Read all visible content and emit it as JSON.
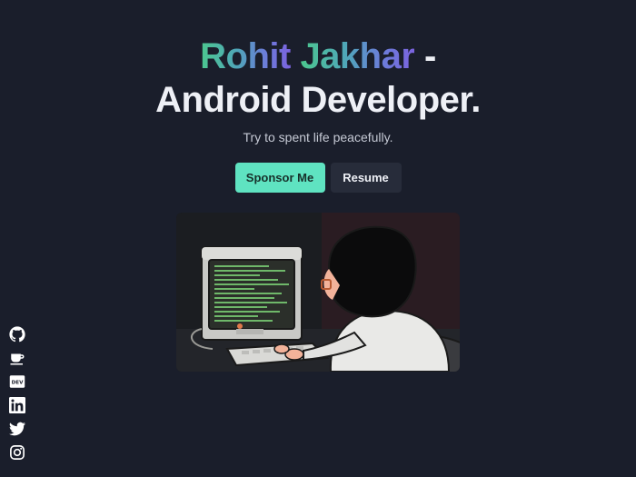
{
  "hero": {
    "first_name": "Rohit",
    "last_name": "Jakhar",
    "dash": "-",
    "role": "Android Developer.",
    "tagline": "Try to spent life peacefully."
  },
  "buttons": {
    "sponsor_label": "Sponsor Me",
    "resume_label": "Resume"
  },
  "illustration": {
    "subject": "developer-at-retro-computer"
  },
  "social": [
    {
      "icon": "github-icon"
    },
    {
      "icon": "coffee-icon"
    },
    {
      "icon": "dev-icon",
      "text": "DEV"
    },
    {
      "icon": "linkedin-icon"
    },
    {
      "icon": "twitter-icon"
    },
    {
      "icon": "instagram-icon"
    }
  ],
  "colors": {
    "background": "#1a1e2b",
    "accent": "#5fe3c1",
    "secondary_button": "#272c3a",
    "gradient_start": "#4cc88e",
    "gradient_end": "#7b63df"
  }
}
